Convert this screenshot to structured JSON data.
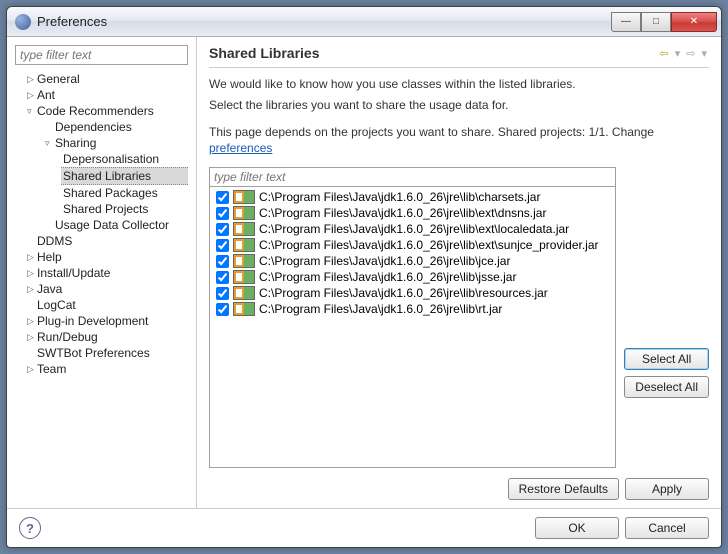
{
  "window": {
    "title": "Preferences"
  },
  "sidebar": {
    "filter_placeholder": "type filter text",
    "items": [
      {
        "label": "General",
        "level": 1,
        "arrow": "▷"
      },
      {
        "label": "Ant",
        "level": 1,
        "arrow": "▷"
      },
      {
        "label": "Code Recommenders",
        "level": 1,
        "arrow": "▿"
      },
      {
        "label": "Dependencies",
        "level": 2
      },
      {
        "label": "Sharing",
        "level": 2,
        "arrow": "▿"
      },
      {
        "label": "Depersonalisation",
        "level": 3
      },
      {
        "label": "Shared Libraries",
        "level": 3,
        "selected": true
      },
      {
        "label": "Shared Packages",
        "level": 3
      },
      {
        "label": "Shared Projects",
        "level": 3
      },
      {
        "label": "Usage Data Collector",
        "level": 2
      },
      {
        "label": "DDMS",
        "level": 1
      },
      {
        "label": "Help",
        "level": 1,
        "arrow": "▷"
      },
      {
        "label": "Install/Update",
        "level": 1,
        "arrow": "▷"
      },
      {
        "label": "Java",
        "level": 1,
        "arrow": "▷"
      },
      {
        "label": "LogCat",
        "level": 1
      },
      {
        "label": "Plug-in Development",
        "level": 1,
        "arrow": "▷"
      },
      {
        "label": "Run/Debug",
        "level": 1,
        "arrow": "▷"
      },
      {
        "label": "SWTBot Preferences",
        "level": 1
      },
      {
        "label": "Team",
        "level": 1,
        "arrow": "▷"
      }
    ]
  },
  "page": {
    "title": "Shared Libraries",
    "desc1": "We would like to know how you use classes within the listed libraries.",
    "desc2": "Select the libraries you want to share the usage data for.",
    "dep_prefix": "This page depends on the projects you want to share. Shared projects: 1/1. Change ",
    "dep_link": "preferences",
    "list_filter_placeholder": "type filter text",
    "items": [
      "C:\\Program Files\\Java\\jdk1.6.0_26\\jre\\lib\\charsets.jar",
      "C:\\Program Files\\Java\\jdk1.6.0_26\\jre\\lib\\ext\\dnsns.jar",
      "C:\\Program Files\\Java\\jdk1.6.0_26\\jre\\lib\\ext\\localedata.jar",
      "C:\\Program Files\\Java\\jdk1.6.0_26\\jre\\lib\\ext\\sunjce_provider.jar",
      "C:\\Program Files\\Java\\jdk1.6.0_26\\jre\\lib\\jce.jar",
      "C:\\Program Files\\Java\\jdk1.6.0_26\\jre\\lib\\jsse.jar",
      "C:\\Program Files\\Java\\jdk1.6.0_26\\jre\\lib\\resources.jar",
      "C:\\Program Files\\Java\\jdk1.6.0_26\\jre\\lib\\rt.jar"
    ],
    "select_all": "Select All",
    "deselect_all": "Deselect All",
    "restore_defaults": "Restore Defaults",
    "apply": "Apply"
  },
  "footer": {
    "ok": "OK",
    "cancel": "Cancel"
  }
}
